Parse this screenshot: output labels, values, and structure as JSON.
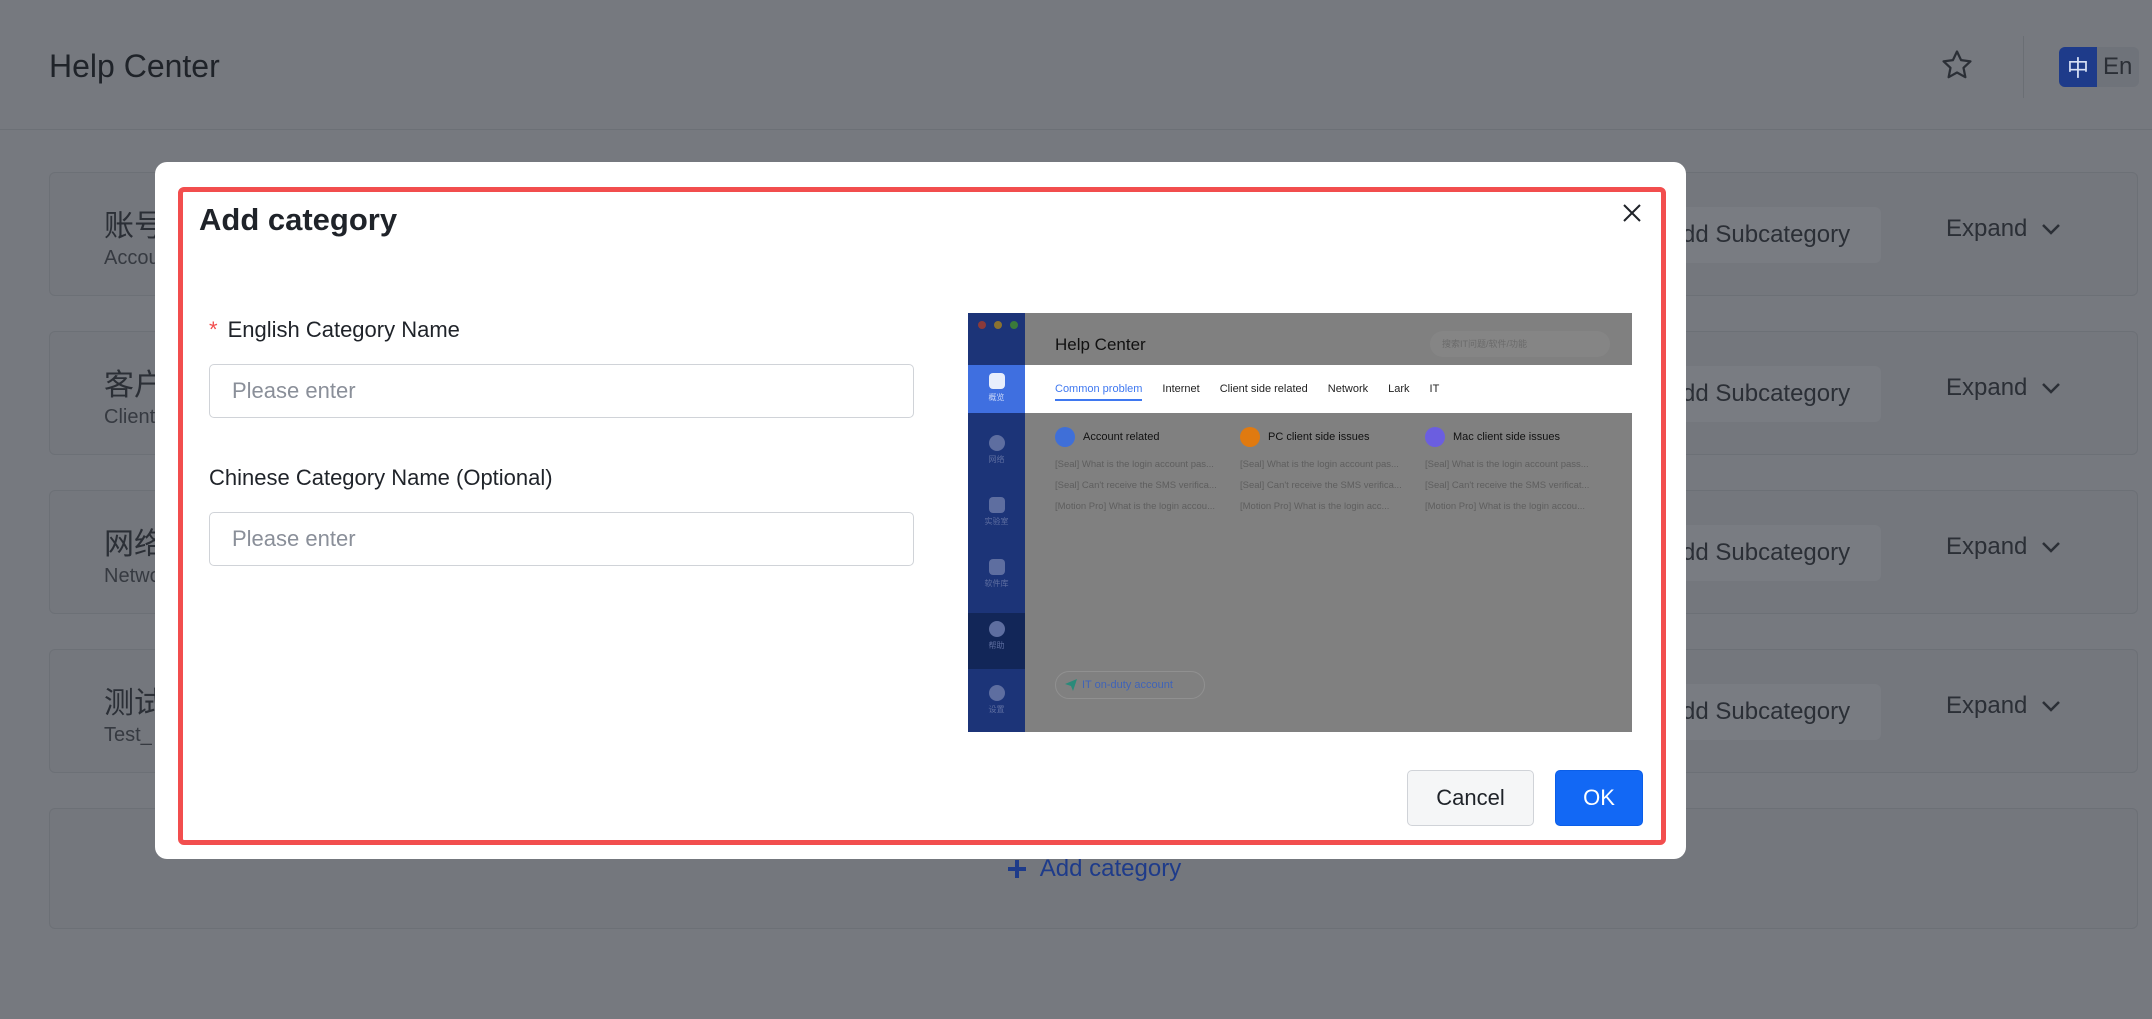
{
  "header": {
    "title": "Help Center",
    "lang_zh": "中",
    "lang_en": "En"
  },
  "categories": [
    {
      "zh": "账号",
      "en": "Accou",
      "add_sub": "dd Subcategory",
      "expand": "Expand"
    },
    {
      "zh": "客户",
      "en": "Client",
      "add_sub": "dd Subcategory",
      "expand": "Expand"
    },
    {
      "zh": "网络",
      "en": "Netwo",
      "add_sub": "dd Subcategory",
      "expand": "Expand"
    },
    {
      "zh": "测试",
      "en": "Test_",
      "add_sub": "dd Subcategory",
      "expand": "Expand"
    }
  ],
  "add_category": "Add category",
  "modal": {
    "title": "Add category",
    "english_label": "English Category Name",
    "required_mark": "*",
    "english_placeholder": "Please enter",
    "chinese_label": "Chinese Category Name (Optional)",
    "chinese_placeholder": "Please enter",
    "cancel": "Cancel",
    "ok": "OK",
    "highlight_color": "#f24e4e",
    "primary_color": "#1268f5"
  },
  "preview": {
    "title": "Help Center",
    "search_placeholder": "搜索IT问题/软件/功能",
    "sidebar": [
      "概览",
      "网络",
      "实验室",
      "软件库",
      "帮助",
      "设置"
    ],
    "tabs": [
      "Common problem",
      "Internet",
      "Client side related",
      "Network",
      "Lark",
      "IT"
    ],
    "columns": [
      {
        "title": "Account related",
        "color": "#3f78f0",
        "links": [
          "[Seal] What is the login account pas...",
          "[Seal] Can't receive the SMS verifica...",
          "[Motion Pro] What is the login accou..."
        ]
      },
      {
        "title": "PC client side issues",
        "color": "#f08a14",
        "links": [
          "[Seal] What is the login account pas...",
          "[Seal] Can't receive the SMS verifica...",
          "[Motion Pro] What is the login acc..."
        ]
      },
      {
        "title": "Mac client side issues",
        "color": "#7b6cf0",
        "links": [
          "[Seal] What is the login account pass...",
          "[Seal] Can't receive the SMS verificat...",
          "[Motion Pro] What is the login accou..."
        ]
      }
    ],
    "duty": "IT on-duty account"
  }
}
